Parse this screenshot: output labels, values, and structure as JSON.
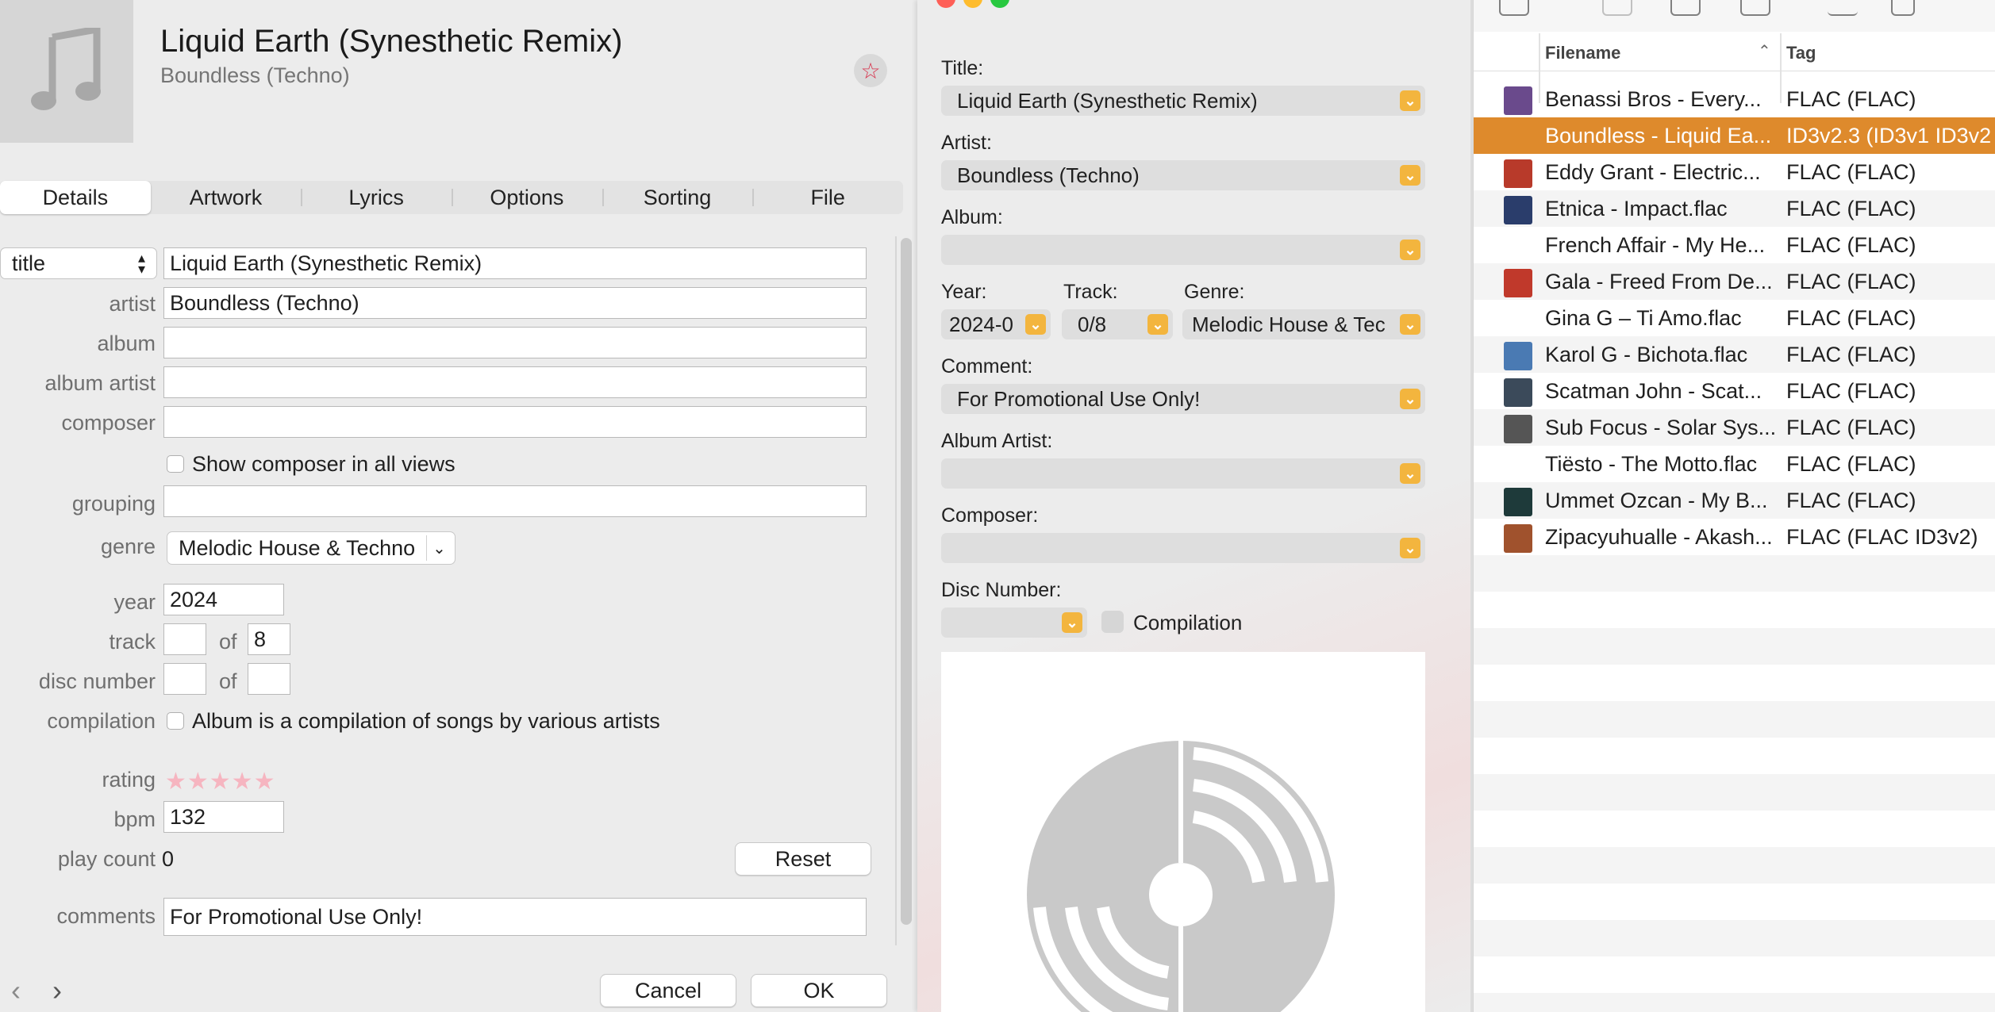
{
  "left": {
    "song_title": "Liquid Earth (Synesthetic Remix)",
    "song_artist": "Boundless (Techno)",
    "tabs": [
      "Details",
      "Artwork",
      "Lyrics",
      "Options",
      "Sorting",
      "File"
    ],
    "active_tab": "Details",
    "field_select": "title",
    "title_value": "Liquid Earth (Synesthetic Remix)",
    "labels": {
      "artist": "artist",
      "album": "album",
      "album_artist": "album artist",
      "composer": "composer",
      "grouping": "grouping",
      "genre": "genre",
      "year": "year",
      "track": "track",
      "disc_number": "disc number",
      "compilation": "compilation",
      "rating": "rating",
      "bpm": "bpm",
      "play_count": "play count",
      "comments": "comments",
      "of": "of"
    },
    "values": {
      "artist": "Boundless (Techno)",
      "album": "",
      "album_artist": "",
      "composer": "",
      "grouping": "",
      "genre": "Melodic House & Techno",
      "year": "2024",
      "track_number": "",
      "track_total": "8",
      "disc_number": "",
      "disc_total": "",
      "bpm": "132",
      "play_count": "0",
      "comments": "For Promotional Use Only!"
    },
    "show_composer_label": "Show composer in all views",
    "compilation_label": "Album is a compilation of songs by various artists",
    "rating_stars": "★★★★★",
    "rating_value": 0,
    "reset_label": "Reset",
    "cancel_label": "Cancel",
    "ok_label": "OK",
    "nav_prev": "‹",
    "nav_next": "›"
  },
  "middle": {
    "labels": {
      "title": "Title:",
      "artist": "Artist:",
      "album": "Album:",
      "year": "Year:",
      "track": "Track:",
      "genre": "Genre:",
      "comment": "Comment:",
      "album_artist": "Album Artist:",
      "composer": "Composer:",
      "disc_number": "Disc Number:",
      "compilation": "Compilation"
    },
    "values": {
      "title": "Liquid Earth (Synesthetic Remix)",
      "artist": "Boundless (Techno)",
      "album": "",
      "year": "2024-0",
      "track": "0/8",
      "genre": "Melodic House & Tec",
      "comment": "For Promotional Use Only!",
      "album_artist": "",
      "composer": "",
      "disc_number": ""
    },
    "colors": {
      "close": "#fe5f57",
      "minimize": "#febc2e",
      "zoom": "#28c840",
      "accent": "#f3b53e"
    }
  },
  "right": {
    "columns": {
      "filename": "Filename",
      "tag": "Tag"
    },
    "files": [
      {
        "name": "Benassi Bros - Every...",
        "tag": "FLAC (FLAC)",
        "thumb": "#6a4a8c"
      },
      {
        "name": "Boundless - Liquid Ea...",
        "tag": "ID3v2.3 (ID3v1 ID3v2",
        "thumb": ""
      },
      {
        "name": "Eddy Grant - Electric...",
        "tag": "FLAC (FLAC)",
        "thumb": "#b83a2a"
      },
      {
        "name": "Etnica - Impact.flac",
        "tag": "FLAC (FLAC)",
        "thumb": "#2a3d6b"
      },
      {
        "name": "French Affair - My He...",
        "tag": "FLAC (FLAC)",
        "thumb": ""
      },
      {
        "name": "Gala - Freed From De...",
        "tag": "FLAC (FLAC)",
        "thumb": "#c0392b"
      },
      {
        "name": "Gina G – Ti Amo.flac",
        "tag": "FLAC (FLAC)",
        "thumb": ""
      },
      {
        "name": "Karol G - Bichota.flac",
        "tag": "FLAC (FLAC)",
        "thumb": "#4a7ab3"
      },
      {
        "name": "Scatman John - Scat...",
        "tag": "FLAC (FLAC)",
        "thumb": "#3b4a5a"
      },
      {
        "name": "Sub Focus - Solar Sys...",
        "tag": "FLAC (FLAC)",
        "thumb": "#555555"
      },
      {
        "name": "Tiësto - The Motto.flac",
        "tag": "FLAC (FLAC)",
        "thumb": ""
      },
      {
        "name": "Ummet Ozcan - My B...",
        "tag": "FLAC (FLAC)",
        "thumb": "#1e3a3a"
      },
      {
        "name": "Zipacyuhualle - Akash...",
        "tag": "FLAC (FLAC ID3v2)",
        "thumb": "#a0522d"
      }
    ],
    "selected_index": 1,
    "colors": {
      "selection": "#de8a2c"
    }
  }
}
